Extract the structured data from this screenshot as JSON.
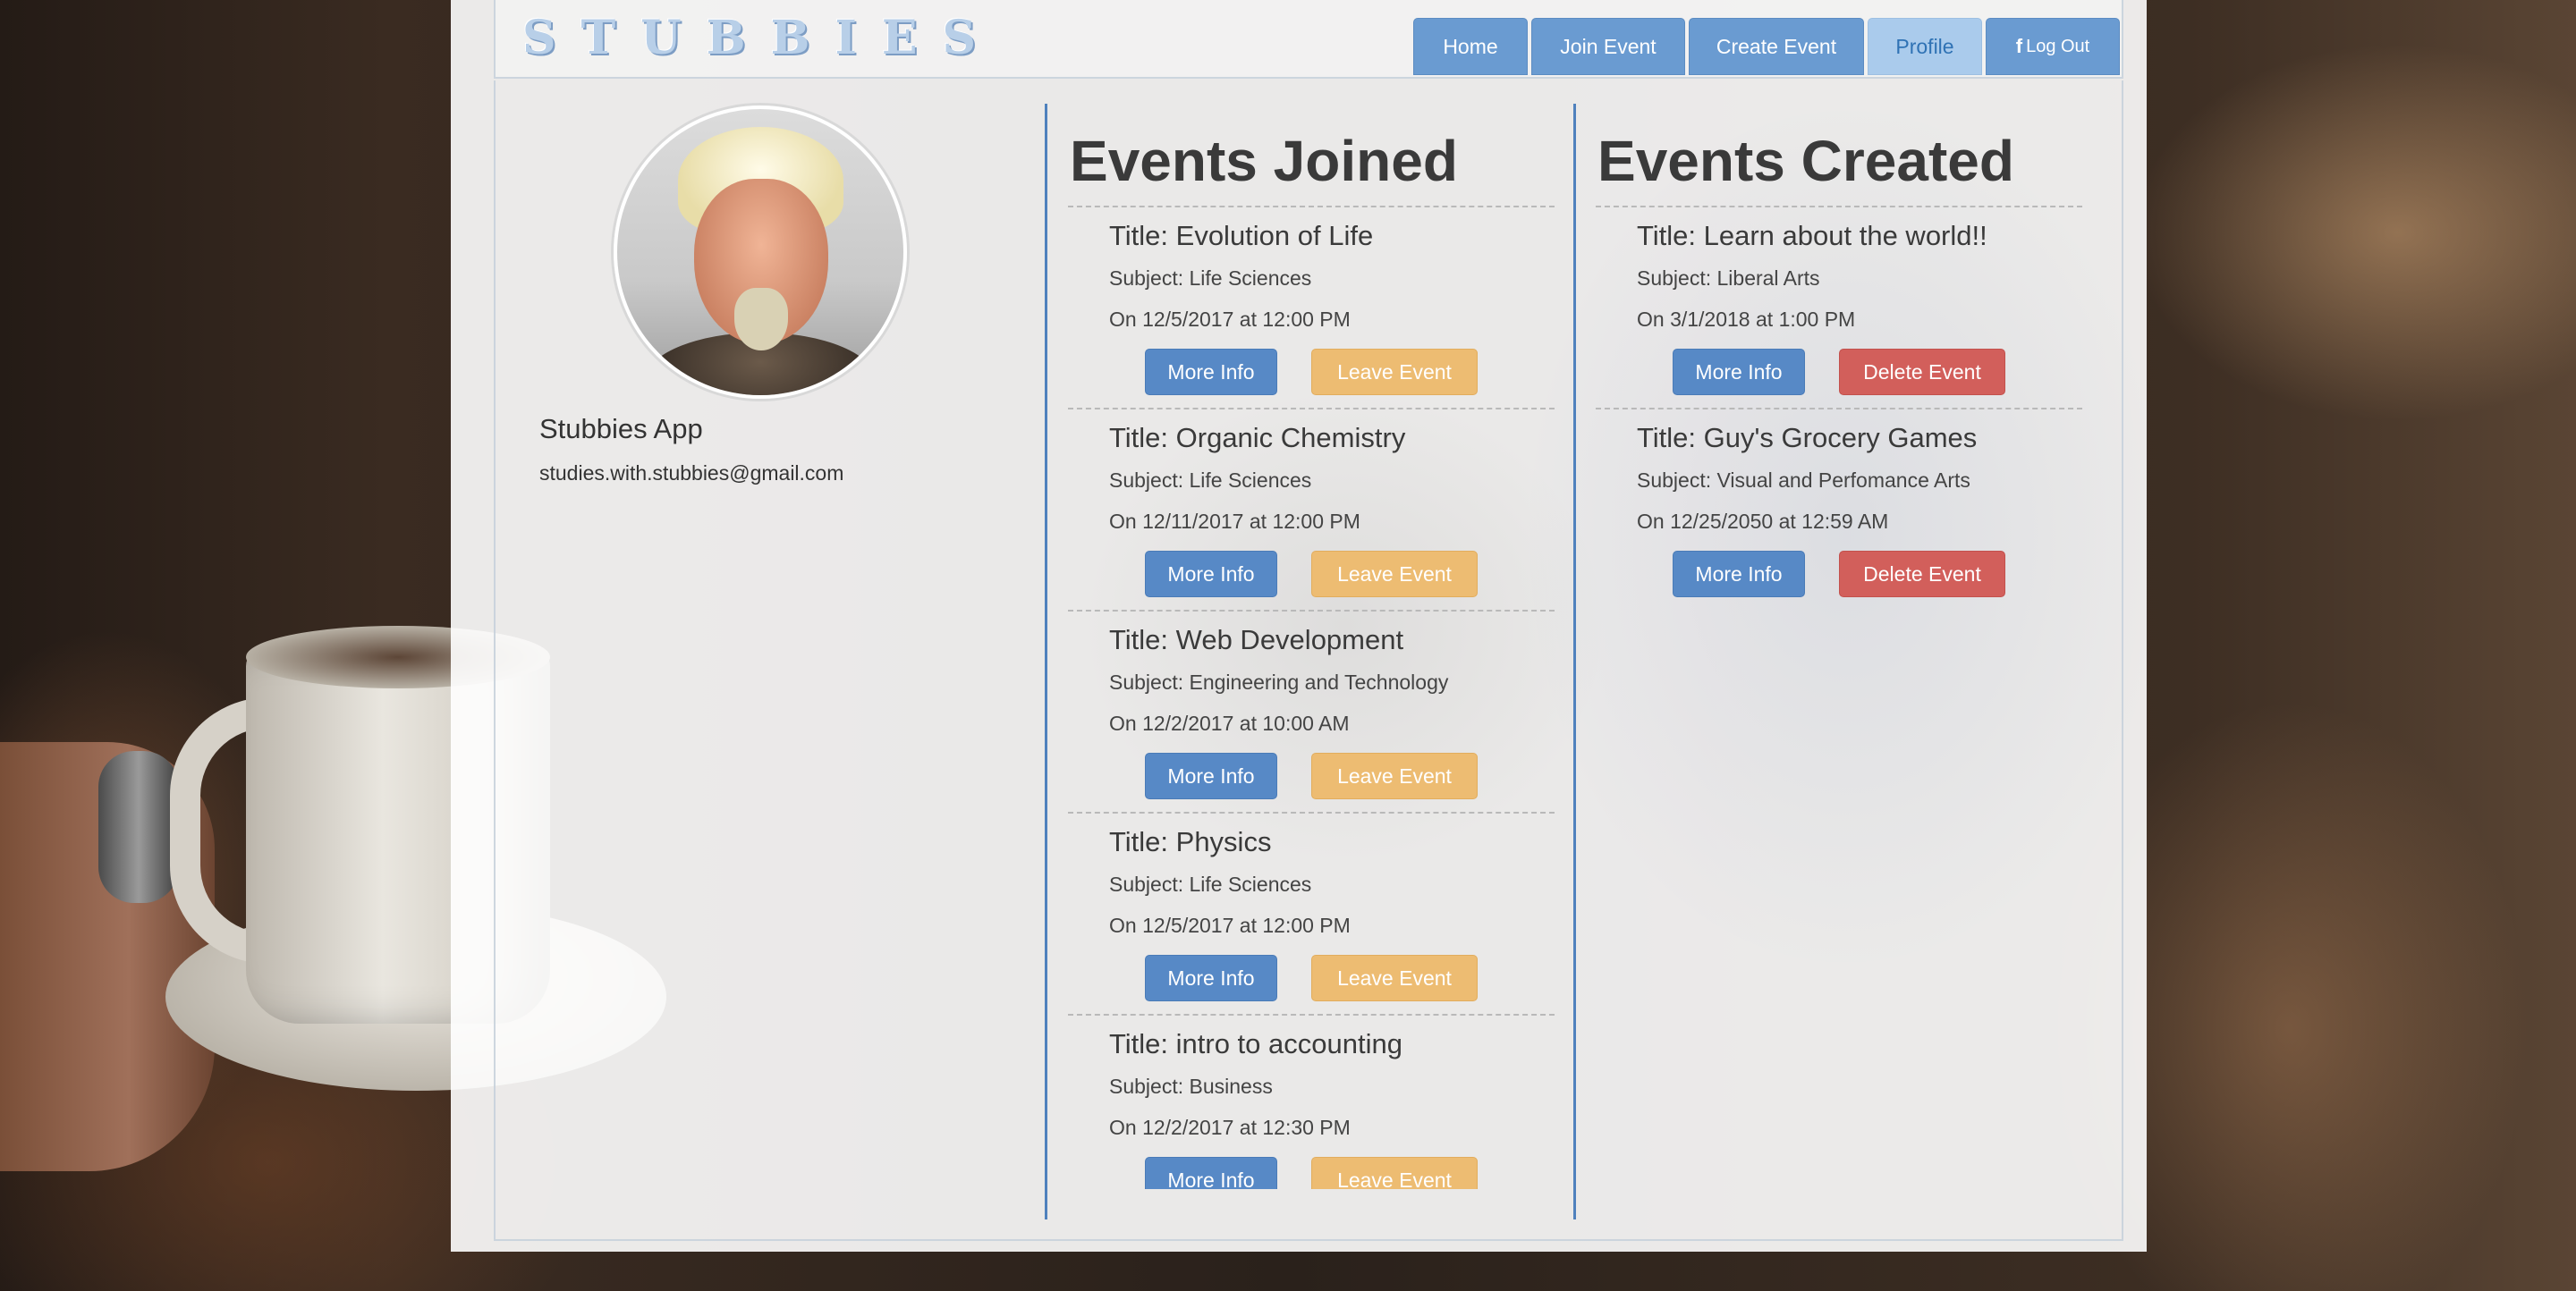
{
  "brand": {
    "logo_text": "STUBBIES"
  },
  "nav": {
    "home": "Home",
    "join_event": "Join Event",
    "create_event": "Create Event",
    "profile": "Profile",
    "logout_icon": "f",
    "logout": "Log Out"
  },
  "profile": {
    "avatar_icon": "user-photo",
    "name": "Stubbies App",
    "email": "studies.with.stubbies@gmail.com"
  },
  "events_joined": {
    "heading": "Events Joined",
    "items": [
      {
        "title": "Title: Evolution of Life",
        "subject": "Subject: Life Sciences",
        "date": "On 12/5/2017 at 12:00 PM",
        "info_label": "More Info",
        "action_label": "Leave Event"
      },
      {
        "title": "Title: Organic Chemistry",
        "subject": "Subject: Life Sciences",
        "date": "On 12/11/2017 at 12:00 PM",
        "info_label": "More Info",
        "action_label": "Leave Event"
      },
      {
        "title": "Title: Web Development",
        "subject": "Subject: Engineering and Technology",
        "date": "On 12/2/2017 at 10:00 AM",
        "info_label": "More Info",
        "action_label": "Leave Event"
      },
      {
        "title": "Title: Physics",
        "subject": "Subject: Life Sciences",
        "date": "On 12/5/2017 at 12:00 PM",
        "info_label": "More Info",
        "action_label": "Leave Event"
      },
      {
        "title": "Title: intro to accounting",
        "subject": "Subject: Business",
        "date": "On 12/2/2017 at 12:30 PM",
        "info_label": "More Info",
        "action_label": "Leave Event"
      }
    ]
  },
  "events_created": {
    "heading": "Events Created",
    "items": [
      {
        "title": "Title: Learn about the world!!",
        "subject": "Subject: Liberal Arts",
        "date": "On 3/1/2018 at 1:00 PM",
        "info_label": "More Info",
        "action_label": "Delete Event"
      },
      {
        "title": "Title: Guy's Grocery Games",
        "subject": "Subject: Visual and Perfomance Arts",
        "date": "On 12/25/2050 at 12:59 AM",
        "info_label": "More Info",
        "action_label": "Delete Event"
      }
    ]
  },
  "colors": {
    "primary": "#5789c6",
    "warning": "#edbc72",
    "danger": "#d25f5b",
    "divider": "#4f81bd",
    "nav_active": "#aacbec"
  }
}
